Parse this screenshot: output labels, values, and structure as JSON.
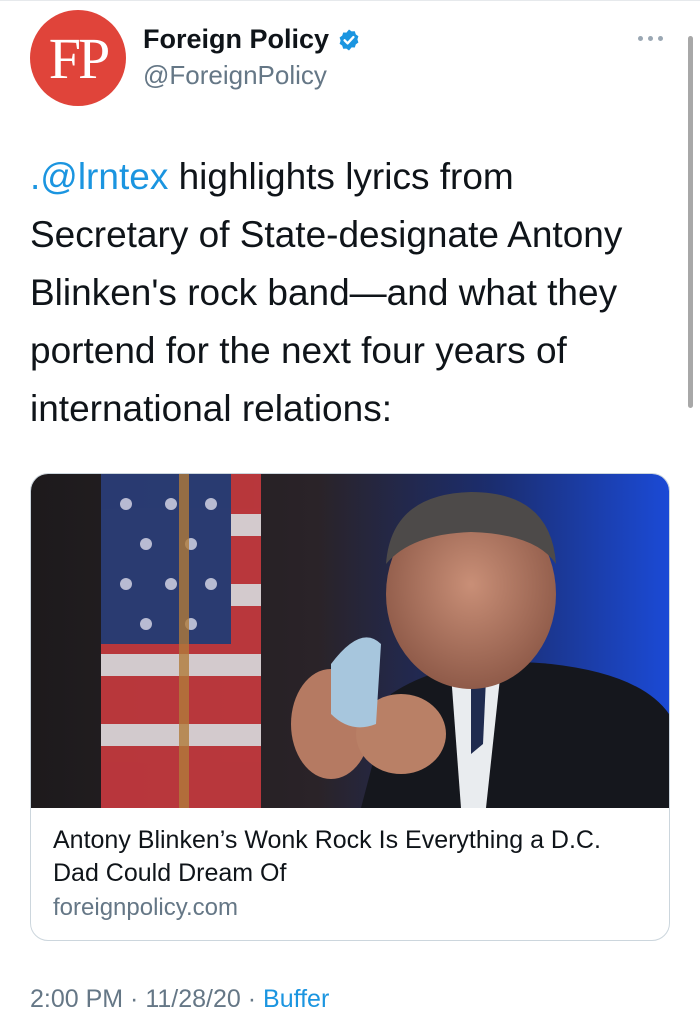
{
  "author": {
    "avatar_initials": "FP",
    "display_name": "Foreign Policy",
    "handle": "@ForeignPolicy",
    "verified": true
  },
  "tweet": {
    "mention": ".@lrntex",
    "text": " highlights lyrics from Secretary of State-designate Antony Blinken's rock band—and what they portend for the next four years of international relations:"
  },
  "card": {
    "title": "Antony Blinken’s Wonk Rock Is Everything a D.C. Dad Could Dream Of",
    "domain": "foreignpolicy.com"
  },
  "meta": {
    "time": "2:00 PM",
    "separator": " · ",
    "date": "11/28/20",
    "source": "Buffer"
  },
  "colors": {
    "link": "#1b95e0",
    "avatar_bg": "#e0443a",
    "secondary_text": "#657786"
  },
  "icons": [
    "verified-badge-icon",
    "more-options-icon"
  ]
}
